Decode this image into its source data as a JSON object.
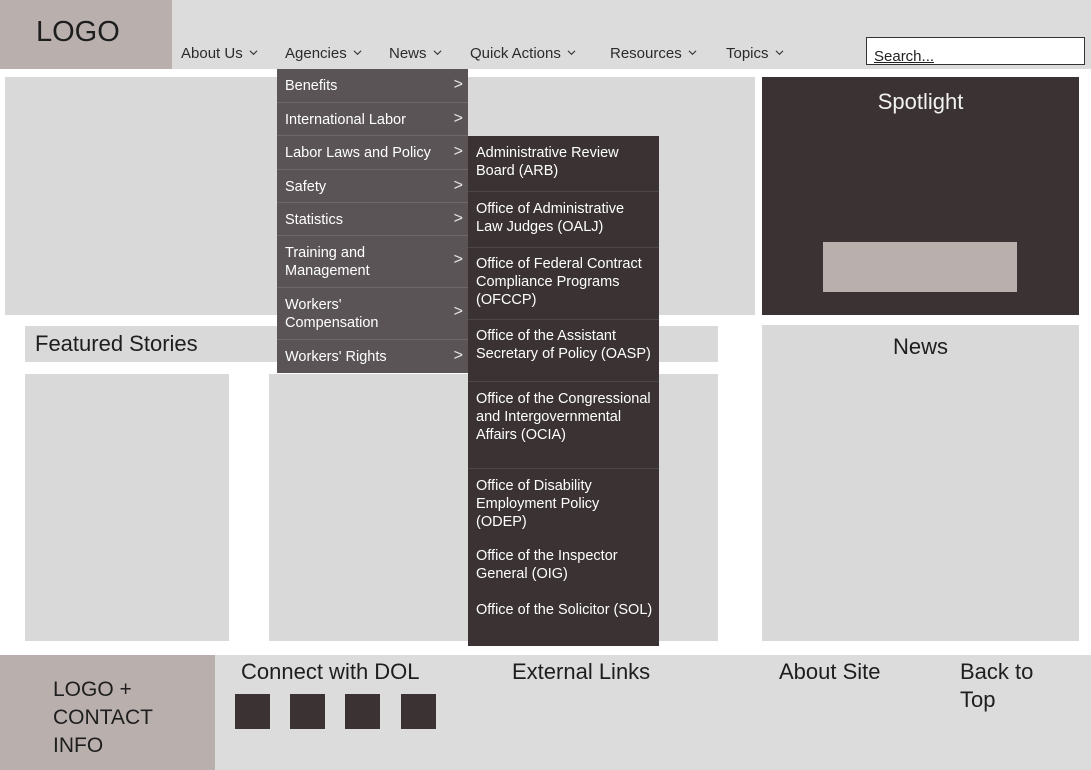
{
  "header": {
    "logo": "LOGO",
    "nav": [
      {
        "label": "About Us"
      },
      {
        "label": "Agencies"
      },
      {
        "label": "News"
      },
      {
        "label": "Quick Actions"
      },
      {
        "label": "Resources"
      },
      {
        "label": "Topics"
      }
    ],
    "search_placeholder": "Search..."
  },
  "agencies_menu": {
    "items": [
      {
        "label": "Benefits",
        "arrow": ">"
      },
      {
        "label": "International Labor",
        "arrow": ">"
      },
      {
        "label": "Labor Laws and Policy",
        "arrow": ">"
      },
      {
        "label": "Safety",
        "arrow": ">"
      },
      {
        "label": "Statistics",
        "arrow": ">"
      },
      {
        "label": "Training and Management",
        "arrow": ">"
      },
      {
        "label": "Workers' Compensation",
        "arrow": ">"
      },
      {
        "label": "Workers' Rights",
        "arrow": ">"
      }
    ]
  },
  "labor_laws_submenu": {
    "items": [
      {
        "label": "Administrative Review Board (ARB)"
      },
      {
        "label": "Office of Administrative Law Judges (OALJ)"
      },
      {
        "label": "Office of Federal Contract Compliance Programs (OFCCP)"
      },
      {
        "label": "Office of the Assistant Secretary of Policy (OASP)"
      },
      {
        "label": "Office of the Congressional and Intergovernmental Affairs (OCIA)"
      },
      {
        "label": "Office of Disability Employment Policy (ODEP)"
      },
      {
        "label": "Office of the Inspector General (OIG)"
      },
      {
        "label": "Office of the Solicitor (SOL)"
      }
    ]
  },
  "spotlight": {
    "title": "Spotlight"
  },
  "featured": {
    "title": "Featured Stories"
  },
  "news": {
    "title": "News"
  },
  "footer": {
    "logo_contact": "LOGO + CONTACT INFO",
    "connect": "Connect with DOL",
    "external_links": "External Links",
    "about_site": "About Site",
    "back_to_top": "Back to Top"
  },
  "colors": {
    "header_bg": "#dcdcdc",
    "logo_bg": "#b9b0ae",
    "menu_bg": "#5a5456",
    "submenu_bg": "#3a3233",
    "placeholder_gray": "#d9d9d9"
  },
  "icons": {
    "nav_chevron": "chevron-down-icon",
    "menu_arrow": "chevron-right-icon",
    "social": "social-media-icon"
  }
}
